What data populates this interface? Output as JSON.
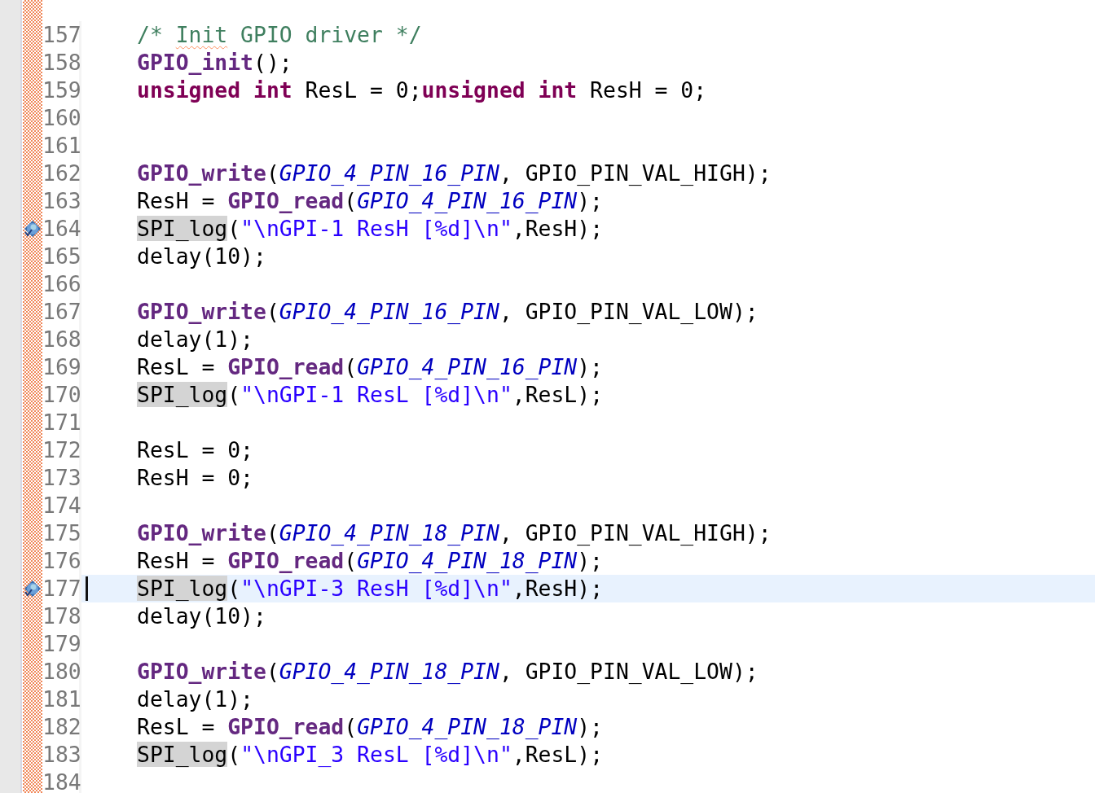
{
  "lines": [
    {
      "number": "157",
      "breakpoint": false,
      "current": false,
      "tokens": [
        {
          "text": "/* ",
          "kind": "comment"
        },
        {
          "text": "Init",
          "kind": "misspelled"
        },
        {
          "text": " GPIO driver */",
          "kind": "comment"
        }
      ]
    },
    {
      "number": "158",
      "breakpoint": false,
      "current": false,
      "tokens": [
        {
          "text": "GPIO_init",
          "kind": "function"
        },
        {
          "text": "();",
          "kind": "plain"
        }
      ]
    },
    {
      "number": "159",
      "breakpoint": false,
      "current": false,
      "tokens": [
        {
          "text": "unsigned int",
          "kind": "keyword"
        },
        {
          "text": " ResL = 0;",
          "kind": "plain"
        },
        {
          "text": "unsigned int",
          "kind": "keyword"
        },
        {
          "text": " ResH = 0;",
          "kind": "plain"
        }
      ]
    },
    {
      "number": "160",
      "breakpoint": false,
      "current": false
    },
    {
      "number": "161",
      "breakpoint": false,
      "current": false
    },
    {
      "number": "162",
      "breakpoint": false,
      "current": false,
      "tokens": [
        {
          "text": "GPIO_write",
          "kind": "function"
        },
        {
          "text": "(",
          "kind": "plain"
        },
        {
          "text": "GPIO_4_PIN_16_PIN",
          "kind": "macro"
        },
        {
          "text": ", GPIO_PIN_VAL_HIGH);",
          "kind": "plain"
        }
      ]
    },
    {
      "number": "163",
      "breakpoint": false,
      "current": false,
      "tokens": [
        {
          "text": "ResH = ",
          "kind": "plain"
        },
        {
          "text": "GPIO_read",
          "kind": "function"
        },
        {
          "text": "(",
          "kind": "plain"
        },
        {
          "text": "GPIO_4_PIN_16_PIN",
          "kind": "macro"
        },
        {
          "text": ");",
          "kind": "plain"
        }
      ]
    },
    {
      "number": "164",
      "breakpoint": true,
      "current": false,
      "tokens": [
        {
          "text": "SPI_log",
          "kind": "occurrence"
        },
        {
          "text": "(",
          "kind": "plain"
        },
        {
          "text": "\"\\nGPI-1 ResH [%d]\\n\"",
          "kind": "string"
        },
        {
          "text": ",ResH);",
          "kind": "plain"
        }
      ]
    },
    {
      "number": "165",
      "breakpoint": false,
      "current": false,
      "tokens": [
        {
          "text": "delay(10);",
          "kind": "plain"
        }
      ]
    },
    {
      "number": "166",
      "breakpoint": false,
      "current": false
    },
    {
      "number": "167",
      "breakpoint": false,
      "current": false,
      "tokens": [
        {
          "text": "GPIO_write",
          "kind": "function"
        },
        {
          "text": "(",
          "kind": "plain"
        },
        {
          "text": "GPIO_4_PIN_16_PIN",
          "kind": "macro"
        },
        {
          "text": ", GPIO_PIN_VAL_LOW);",
          "kind": "plain"
        }
      ]
    },
    {
      "number": "168",
      "breakpoint": false,
      "current": false,
      "tokens": [
        {
          "text": "delay(1);",
          "kind": "plain"
        }
      ]
    },
    {
      "number": "169",
      "breakpoint": false,
      "current": false,
      "tokens": [
        {
          "text": "ResL = ",
          "kind": "plain"
        },
        {
          "text": "GPIO_read",
          "kind": "function"
        },
        {
          "text": "(",
          "kind": "plain"
        },
        {
          "text": "GPIO_4_PIN_16_PIN",
          "kind": "macro"
        },
        {
          "text": ");",
          "kind": "plain"
        }
      ]
    },
    {
      "number": "170",
      "breakpoint": false,
      "current": false,
      "tokens": [
        {
          "text": "SPI_log",
          "kind": "occurrence"
        },
        {
          "text": "(",
          "kind": "plain"
        },
        {
          "text": "\"\\nGPI-1 ResL [%d]\\n\"",
          "kind": "string"
        },
        {
          "text": ",ResL);",
          "kind": "plain"
        }
      ]
    },
    {
      "number": "171",
      "breakpoint": false,
      "current": false
    },
    {
      "number": "172",
      "breakpoint": false,
      "current": false,
      "tokens": [
        {
          "text": "ResL = 0;",
          "kind": "plain"
        }
      ]
    },
    {
      "number": "173",
      "breakpoint": false,
      "current": false,
      "tokens": [
        {
          "text": "ResH = 0;",
          "kind": "plain"
        }
      ]
    },
    {
      "number": "174",
      "breakpoint": false,
      "current": false
    },
    {
      "number": "175",
      "breakpoint": false,
      "current": false,
      "tokens": [
        {
          "text": "GPIO_write",
          "kind": "function"
        },
        {
          "text": "(",
          "kind": "plain"
        },
        {
          "text": "GPIO_4_PIN_18_PIN",
          "kind": "macro"
        },
        {
          "text": ", GPIO_PIN_VAL_HIGH);",
          "kind": "plain"
        }
      ]
    },
    {
      "number": "176",
      "breakpoint": false,
      "current": false,
      "tokens": [
        {
          "text": "ResH = ",
          "kind": "plain"
        },
        {
          "text": "GPIO_read",
          "kind": "function"
        },
        {
          "text": "(",
          "kind": "plain"
        },
        {
          "text": "GPIO_4_PIN_18_PIN",
          "kind": "macro"
        },
        {
          "text": ");",
          "kind": "plain"
        }
      ]
    },
    {
      "number": "177",
      "breakpoint": true,
      "current": true,
      "tokens": [
        {
          "text": "SPI_log",
          "kind": "occurrence"
        },
        {
          "text": "(",
          "kind": "plain"
        },
        {
          "text": "\"\\nGPI-3 ResH [%d]\\n\"",
          "kind": "string"
        },
        {
          "text": ",ResH);",
          "kind": "plain"
        }
      ]
    },
    {
      "number": "178",
      "breakpoint": false,
      "current": false,
      "tokens": [
        {
          "text": "delay(10);",
          "kind": "plain"
        }
      ]
    },
    {
      "number": "179",
      "breakpoint": false,
      "current": false
    },
    {
      "number": "180",
      "breakpoint": false,
      "current": false,
      "tokens": [
        {
          "text": "GPIO_write",
          "kind": "function"
        },
        {
          "text": "(",
          "kind": "plain"
        },
        {
          "text": "GPIO_4_PIN_18_PIN",
          "kind": "macro"
        },
        {
          "text": ", GPIO_PIN_VAL_LOW);",
          "kind": "plain"
        }
      ]
    },
    {
      "number": "181",
      "breakpoint": false,
      "current": false,
      "tokens": [
        {
          "text": "delay(1);",
          "kind": "plain"
        }
      ]
    },
    {
      "number": "182",
      "breakpoint": false,
      "current": false,
      "tokens": [
        {
          "text": "ResL = ",
          "kind": "plain"
        },
        {
          "text": "GPIO_read",
          "kind": "function"
        },
        {
          "text": "(",
          "kind": "plain"
        },
        {
          "text": "GPIO_4_PIN_18_PIN",
          "kind": "macro"
        },
        {
          "text": ");",
          "kind": "plain"
        }
      ]
    },
    {
      "number": "183",
      "breakpoint": false,
      "current": false,
      "tokens": [
        {
          "text": "SPI_log",
          "kind": "occurrence"
        },
        {
          "text": "(",
          "kind": "plain"
        },
        {
          "text": "\"\\nGPI_3 ResL [%d]\\n\"",
          "kind": "string"
        },
        {
          "text": ",ResL);",
          "kind": "plain"
        }
      ]
    },
    {
      "number": "184",
      "breakpoint": false,
      "current": false
    }
  ]
}
